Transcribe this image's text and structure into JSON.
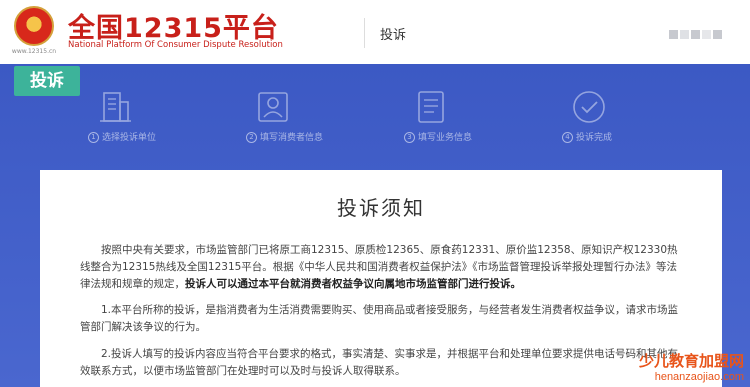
{
  "header": {
    "emblem_url": "www.12315.cn",
    "title": "全国12315平台",
    "subtitle": "National Platform Of Consumer Dispute Resolution",
    "tag": "投诉"
  },
  "banner": {
    "tab_label": "投诉",
    "steps": [
      {
        "num": "1",
        "label": "选择投诉单位",
        "icon": "building-icon"
      },
      {
        "num": "2",
        "label": "填写消费者信息",
        "icon": "user-card-icon"
      },
      {
        "num": "3",
        "label": "填写业务信息",
        "icon": "document-icon"
      },
      {
        "num": "4",
        "label": "投诉完成",
        "icon": "check-circle-icon"
      }
    ]
  },
  "notice": {
    "title": "投诉须知",
    "para1_text": "按照中央有关要求，市场监管部门已将原工商12315、原质检12365、原食药12331、原价监12358、原知识产权12330热线整合为12315热线及全国12315平台。根据《中华人民共和国消费者权益保护法》《市场监督管理投诉举报处理暂行办法》等法律法规和规章的规定，",
    "para1_bold": "投诉人可以通过本平台就消费者权益争议向属地市场监管部门进行投诉。",
    "para2": "1.本平台所称的投诉，是指消费者为生活消费需要购买、使用商品或者接受服务，与经营者发生消费者权益争议，请求市场监管部门解决该争议的行为。",
    "para3": "2.投诉人填写的投诉内容应当符合平台要求的格式，事实清楚、实事求是，并根据平台和处理单位要求提供电话号码和其他有效联系方式，以便市场监管部门在处理时可以及时与投诉人取得联系。"
  },
  "watermark": {
    "line1": "少儿教育加盟网",
    "line2": "henanzaojiao.com"
  },
  "colors": {
    "brand_red": "#c8201a",
    "banner_blue": "#3d5bc7",
    "tab_green": "#3db39a"
  }
}
